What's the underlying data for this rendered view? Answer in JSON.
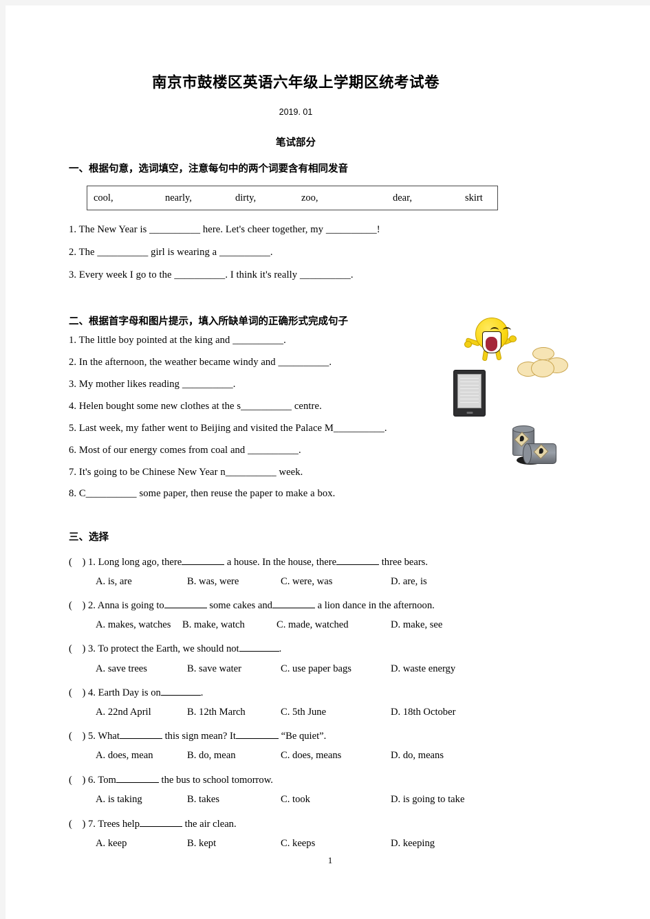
{
  "document": {
    "title": "南京市鼓楼区英语六年级上学期区统考试卷",
    "date": "2019. 01",
    "subtitle": "笔试部分",
    "page_number": "1"
  },
  "section1": {
    "heading": "一、根据句意，选词填空，注意每句中的两个词要含有相同发音",
    "word_bank": [
      "cool,",
      "nearly,",
      "dirty,",
      "zoo,",
      "dear,",
      "skirt"
    ],
    "questions": [
      "1.  The New Year is __________ here. Let's cheer together, my __________!",
      "2.  The __________ girl is wearing a __________.",
      "3.   Every week I go to the __________. I think it's really __________."
    ]
  },
  "section2": {
    "heading": "二、根据首字母和图片提示，填入所缺单词的正确形式完成句子",
    "questions": [
      "1. The little boy pointed at the king and __________.",
      "2. In the afternoon, the weather became windy and __________.",
      "3. My mother likes reading __________.",
      "4. Helen bought some new clothes at the s__________ centre.",
      "5. Last week, my father went to Beijing and visited the Palace M__________.",
      "6. Most of our energy comes from coal and __________.",
      "7. It's going to be Chinese New Year n__________ week.",
      "8. C__________ some paper, then reuse the paper to make a box."
    ],
    "illustrations": [
      {
        "name": "laughing-emoji",
        "alt": "laughing face emoji"
      },
      {
        "name": "clouds",
        "alt": "clouds"
      },
      {
        "name": "e-reader",
        "alt": "e-reader tablet showing a page of text"
      },
      {
        "name": "oil-barrels",
        "alt": "two oil barrels with a spill"
      }
    ]
  },
  "section3": {
    "heading": "三、选择",
    "questions": [
      {
        "marker": "(",
        "close": ")",
        "number": "1.",
        "stem_before": " Long long ago, there",
        "stem_middle": " a house. In the house, there",
        "stem_after": " three bears.",
        "options": [
          "A. is, are",
          "B. was, were",
          "C. were, was",
          "D. are, is"
        ]
      },
      {
        "marker": "(",
        "close": ")",
        "number": "2.",
        "stem_before": " Anna is going to",
        "stem_middle": " some cakes and",
        "stem_after": " a lion dance in the afternoon.",
        "options": [
          "A. makes, watches",
          "B. make, watch",
          "C. made, watched",
          "D. make, see"
        ]
      },
      {
        "marker": "(",
        "close": ")",
        "number": "3.",
        "stem_before": " To protect the Earth, we should not",
        "stem_middle": "",
        "stem_after": ".",
        "options": [
          "A. save trees",
          "B. save water",
          "C. use paper bags",
          "D. waste energy"
        ]
      },
      {
        "marker": "(",
        "close": ")",
        "number": "4.",
        "stem_before": " Earth Day is on",
        "stem_middle": "",
        "stem_after": ".",
        "options": [
          "A. 22nd April",
          "B. 12th March",
          "C. 5th June",
          "D. 18th October"
        ]
      },
      {
        "marker": "(",
        "close": ")",
        "number": "5.",
        "stem_before": " What",
        "stem_middle": " this sign mean? It",
        "stem_after": " “Be quiet”.",
        "options": [
          "A. does, mean",
          "B. do, mean",
          "C. does, means",
          "D. do, means"
        ]
      },
      {
        "marker": "(",
        "close": ")",
        "number": "6.",
        "stem_before": " Tom",
        "stem_middle": " the bus to school tomorrow.",
        "stem_after": "",
        "options": [
          "A. is taking",
          "B. takes",
          "C. took",
          "D. is going to take"
        ]
      },
      {
        "marker": "(",
        "close": ")",
        "number": "7.",
        "stem_before": " Trees help",
        "stem_middle": " the air clean.",
        "stem_after": "",
        "options": [
          "A. keep",
          "B. kept",
          "C. keeps",
          "D. keeping"
        ]
      }
    ]
  },
  "colors": {
    "page_background": "#ffffff",
    "canvas_background": "#f4f4f4",
    "text": "#000000",
    "box_border": "#4a4a4a"
  }
}
